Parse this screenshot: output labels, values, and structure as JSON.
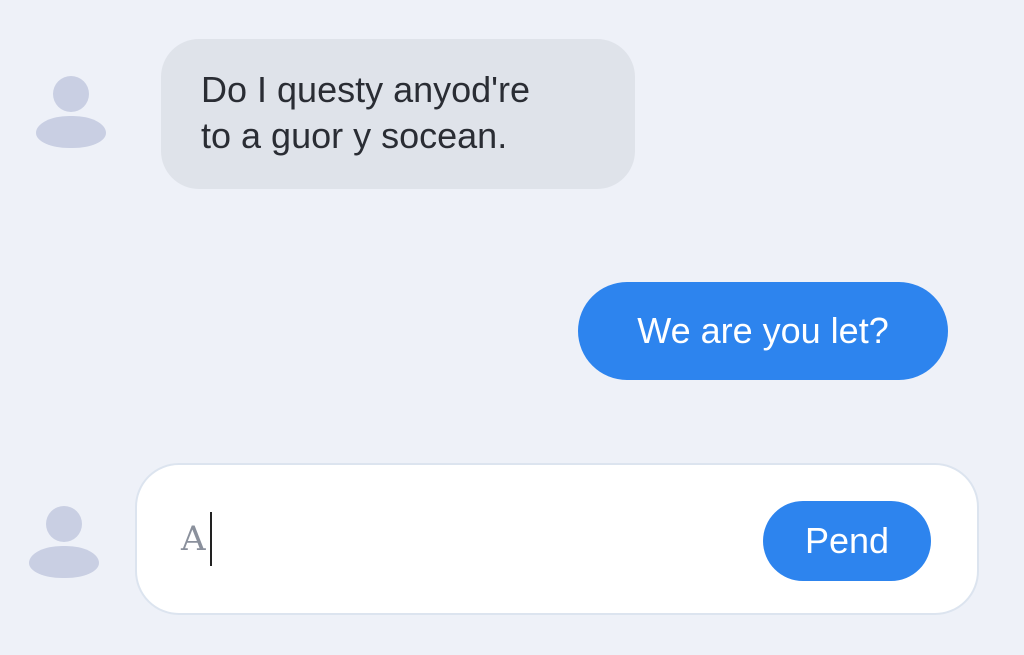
{
  "messages": [
    {
      "direction": "incoming",
      "lines": [
        "Do I questy anyod're",
        "to a guor y socean."
      ]
    },
    {
      "direction": "outgoing",
      "text": "We are you let?"
    }
  ],
  "composer": {
    "value": "A",
    "send_label": "Pend"
  },
  "icons": {
    "avatar": "user-avatar-icon"
  },
  "colors": {
    "background": "#eef1f8",
    "incoming_bubble": "#dfe3ea",
    "outgoing_bubble": "#2d84ee",
    "send_button": "#2d84ee",
    "avatar": "#c9cfe3"
  }
}
